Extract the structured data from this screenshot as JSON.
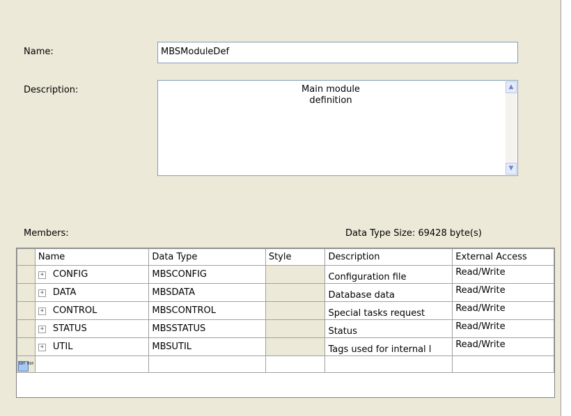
{
  "form": {
    "name_label": "Name:",
    "name_value": "MBSModuleDef",
    "description_label": "Description:",
    "description_value": "Main module\ndefinition",
    "members_label": "Members:",
    "data_type_size": "Data Type Size: 69428 byte(s)"
  },
  "scroll": {
    "up": "▲",
    "down": "▼"
  },
  "table": {
    "headers": [
      "Name",
      "Data Type",
      "Style",
      "Description",
      "External Access"
    ],
    "rows": [
      {
        "name": "CONFIG",
        "type": "MBSCONFIG",
        "style": "",
        "desc": "Configuration file",
        "access": "Read/Write"
      },
      {
        "name": "DATA",
        "type": "MBSDATA",
        "style": "",
        "desc": "Database data",
        "access": "Read/Write"
      },
      {
        "name": "CONTROL",
        "type": "MBSCONTROL",
        "style": "",
        "desc": "Special tasks request",
        "access": "Read/Write"
      },
      {
        "name": "STATUS",
        "type": "MBSSTATUS",
        "style": "",
        "desc": "Status",
        "access": "Read/Write"
      },
      {
        "name": "UTIL",
        "type": "MBSUTIL",
        "style": "",
        "desc": "Tags used for internal l",
        "access": "Read/Write"
      }
    ],
    "expand_glyph": "+",
    "new_row_icon_text": "10f 010"
  },
  "colors": {
    "panel": "#ece9d8",
    "input_border": "#7f9db9",
    "new_row_icon": "#a8c8f0"
  }
}
